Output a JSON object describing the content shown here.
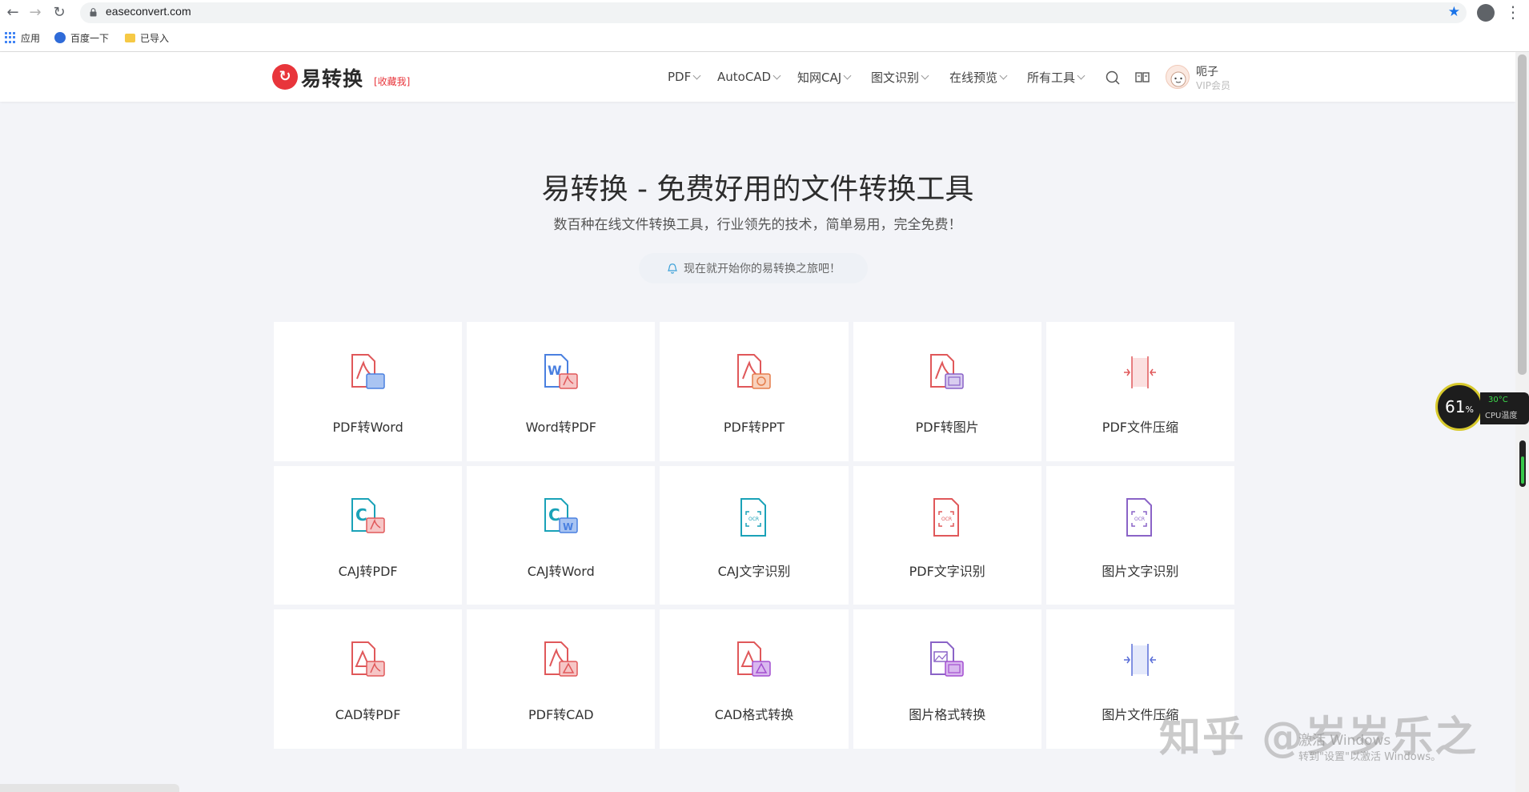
{
  "browser": {
    "url": "easeconvert.com",
    "bookmarks": [
      "应用",
      "百度一下",
      "已导入"
    ]
  },
  "site": {
    "logo_text": "易转换",
    "logo_tag": "[收藏我]",
    "nav": [
      "PDF",
      "AutoCAD",
      "知网CAJ",
      "图文识别",
      "在线预览",
      "所有工具"
    ],
    "user_name": "呃子",
    "user_vip": "VIP会员"
  },
  "hero": {
    "title": "易转换 - 免费好用的文件转换工具",
    "subtitle": "数百种在线文件转换工具，行业领先的技术，简单易用，完全免费！",
    "cta": "现在就开始你的易转换之旅吧！"
  },
  "tools": [
    {
      "label": "PDF转Word",
      "icon": "pdf-to-word-icon"
    },
    {
      "label": "Word转PDF",
      "icon": "word-to-pdf-icon"
    },
    {
      "label": "PDF转PPT",
      "icon": "pdf-to-ppt-icon"
    },
    {
      "label": "PDF转图片",
      "icon": "pdf-to-image-icon"
    },
    {
      "label": "PDF文件压缩",
      "icon": "pdf-compress-icon"
    },
    {
      "label": "CAJ转PDF",
      "icon": "caj-to-pdf-icon"
    },
    {
      "label": "CAJ转Word",
      "icon": "caj-to-word-icon"
    },
    {
      "label": "CAJ文字识别",
      "icon": "caj-ocr-icon"
    },
    {
      "label": "PDF文字识别",
      "icon": "pdf-ocr-icon"
    },
    {
      "label": "图片文字识别",
      "icon": "image-ocr-icon"
    },
    {
      "label": "CAD转PDF",
      "icon": "cad-to-pdf-icon"
    },
    {
      "label": "PDF转CAD",
      "icon": "pdf-to-cad-icon"
    },
    {
      "label": "CAD格式转换",
      "icon": "cad-format-icon"
    },
    {
      "label": "图片格式转换",
      "icon": "image-format-icon"
    },
    {
      "label": "图片文件压缩",
      "icon": "image-compress-icon"
    }
  ],
  "overlay": {
    "cpu_percent": "61",
    "cpu_unit": "%",
    "cpu_temp": "30°C",
    "cpu_label": "CPU温度",
    "watermark": "知乎 @岁岁乐之",
    "activate_line1": "激活 Windows",
    "activate_line2": "转到\"设置\"以激活 Windows。"
  },
  "colors": {
    "brand_red": "#e8353b",
    "page_bg": "#f3f4f8",
    "pdf_red": "#e0585a",
    "word_blue": "#4a80e0",
    "caj_teal": "#1aa2b8",
    "purple": "#8a63c7"
  }
}
